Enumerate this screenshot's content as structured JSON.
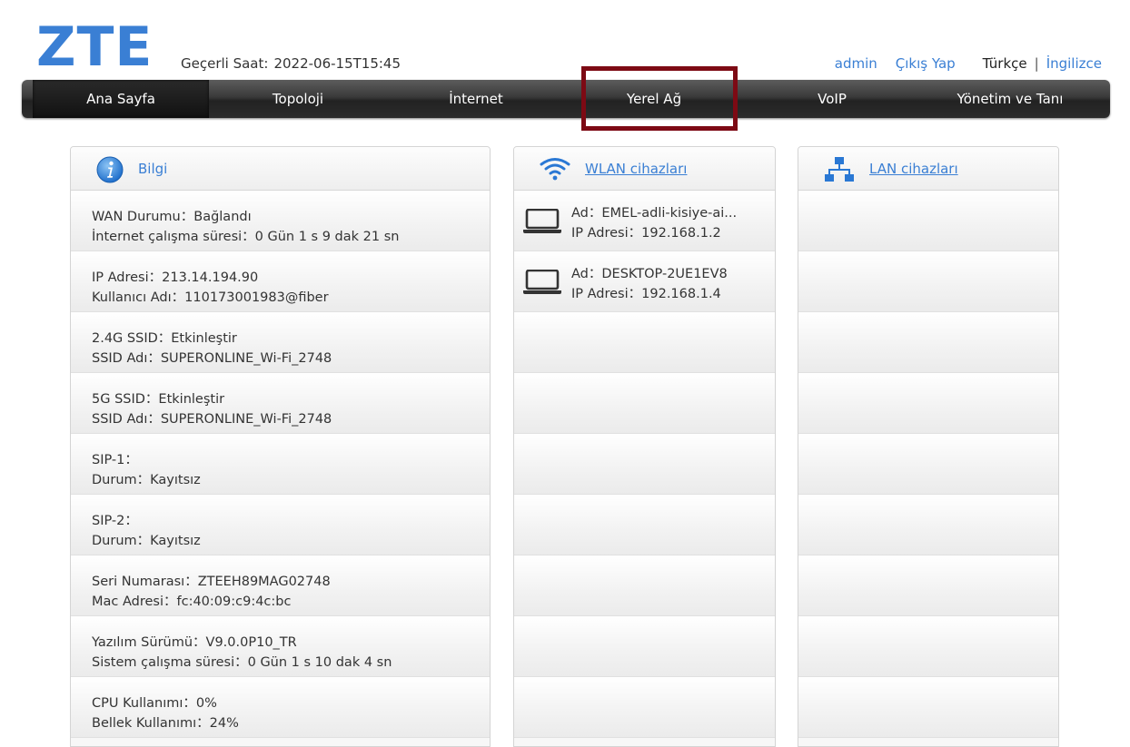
{
  "header": {
    "logo": "ZTE",
    "time_label": "Geçerli Saat:",
    "time_value": "2022-06-15T15:45",
    "user": "admin",
    "logout": "Çıkış Yap",
    "lang_current": "Türkçe",
    "lang_sep": "|",
    "lang_other": "İngilizce"
  },
  "nav": {
    "items": [
      {
        "label": "Ana Sayfa",
        "active": true
      },
      {
        "label": "Topoloji"
      },
      {
        "label": "İnternet"
      },
      {
        "label": "Yerel Ağ"
      },
      {
        "label": "VoIP"
      },
      {
        "label": "Yönetim ve Tanı"
      }
    ]
  },
  "info": {
    "title": "Bilgi",
    "rows": [
      {
        "l1": "WAN Durumu：Bağlandı",
        "l2": "İnternet çalışma süresi：0 Gün 1 s 9 dak 21 sn"
      },
      {
        "l1": "IP Adresi：213.14.194.90",
        "l2": "Kullanıcı Adı：110173001983@fiber"
      },
      {
        "l1": "2.4G SSID：Etkinleştir",
        "l2": "SSID Adı：SUPERONLINE_Wi-Fi_2748"
      },
      {
        "l1": "5G SSID：Etkinleştir",
        "l2": "SSID Adı：SUPERONLINE_Wi-Fi_2748"
      },
      {
        "l1": "SIP-1：",
        "l2": "Durum：Kayıtsız"
      },
      {
        "l1": "SIP-2：",
        "l2": "Durum：Kayıtsız"
      },
      {
        "l1": "Seri Numarası：ZTEEH89MAG02748",
        "l2": "Mac Adresi：fc:40:09:c9:4c:bc"
      },
      {
        "l1": "Yazılım Sürümü：V9.0.0P10_TR",
        "l2": "Sistem çalışma süresi：0 Gün 1 s 10 dak 4 sn"
      },
      {
        "l1": "CPU Kullanımı：0%",
        "l2": "Bellek Kullanımı：24%"
      }
    ]
  },
  "wlan": {
    "title": "WLAN cihazları",
    "devices": [
      {
        "name": "Ad：EMEL-adli-kisiye-ai...",
        "ip": "IP Adresi：192.168.1.2"
      },
      {
        "name": "Ad：DESKTOP-2UE1EV8",
        "ip": "IP Adresi：192.168.1.4"
      }
    ]
  },
  "lan": {
    "title": "LAN cihazları",
    "devices": []
  },
  "colors": {
    "accent": "#3a7fd4",
    "highlight_box": "#7d0a14",
    "nav_bg": "#2c2c2c"
  }
}
